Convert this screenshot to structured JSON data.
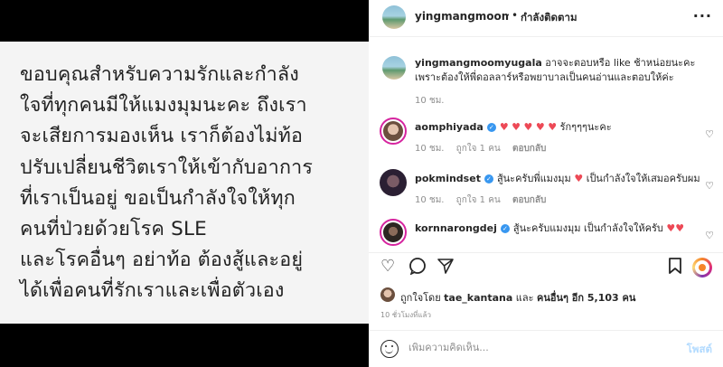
{
  "post_image": {
    "lines": [
      "ขอบคุณสำหรับความรักและกำลัง",
      "ใจที่ทุกคนมีให้แมงมุมนะคะ ถึงเรา",
      "จะเสียการมองเห็น เราก็ต้องไม่ท้อ",
      "ปรับเปลี่ยนชีวิตเราให้เข้ากับอาการ",
      "ที่เราเป็นอยู่ ขอเป็นกำลังใจให้ทุก",
      "คนที่ป่วยด้วยโรค SLE",
      "และโรคอื่นๆ อย่าท้อ ต้องสู้และอยู่",
      "ได้เพื่อคนที่รักเราและเพื่อตัวเอง"
    ]
  },
  "header": {
    "username": "yingmangmoomyugala",
    "dot": "•",
    "follow_status": "กำลังติดตาม",
    "more": "···"
  },
  "caption": {
    "username": "yingmangmoomyugala",
    "text": "อาจจะตอบหรือ like ช้าหน่อยนะคะ เพราะต้องให้พี่ดอลลาร์หรือพยาบาลเป็นคนอ่านและตอบให้ค่ะ",
    "time": "10 ชม."
  },
  "comments": [
    {
      "username": "aomphiyada",
      "text": "❤️❤️❤️❤️❤️ รักๆๆๆนะคะ",
      "hearts": "♥ ♥ ♥ ♥ ♥",
      "suffix": "รักๆๆๆนะคะ",
      "time": "10 ชม.",
      "likes": "ถูกใจ 1 คน",
      "reply": "ตอบกลับ"
    },
    {
      "username": "pokmindset",
      "prefix": "สู้นะครับพี่แมงมุม",
      "heart": "♥",
      "suffix": "เป็นกำลังใจให้เสมอครับผม",
      "time": "10 ชม.",
      "likes": "ถูกใจ 1 คน",
      "reply": "ตอบกลับ"
    },
    {
      "username": "kornnarongdej",
      "prefix": "สู้นะครับแมงมุม เป็นกำลังใจให้ครับ",
      "heart": "♥♥",
      "time": "",
      "likes": "",
      "reply": ""
    }
  ],
  "actions": {
    "like_icon": "heart-outline-icon",
    "comment_icon": "comment-bubble-icon",
    "share_icon": "paper-plane-icon",
    "save_icon": "bookmark-icon"
  },
  "likes": {
    "prefix": "ถูกใจโดย",
    "user": "tae_kantana",
    "middle": "และ",
    "others": "คนอื่นๆ อีก 5,103 คน"
  },
  "post_time": "10 ชั่วโมงที่แล้ว",
  "add_comment": {
    "placeholder": "เพิ่มความคิดเห็น...",
    "post_label": "โพสต์"
  },
  "colors": {
    "verified": "#3897f0",
    "heart": "#ed4956",
    "post_button": "#b3dbff",
    "muted": "#8e8e8e"
  }
}
